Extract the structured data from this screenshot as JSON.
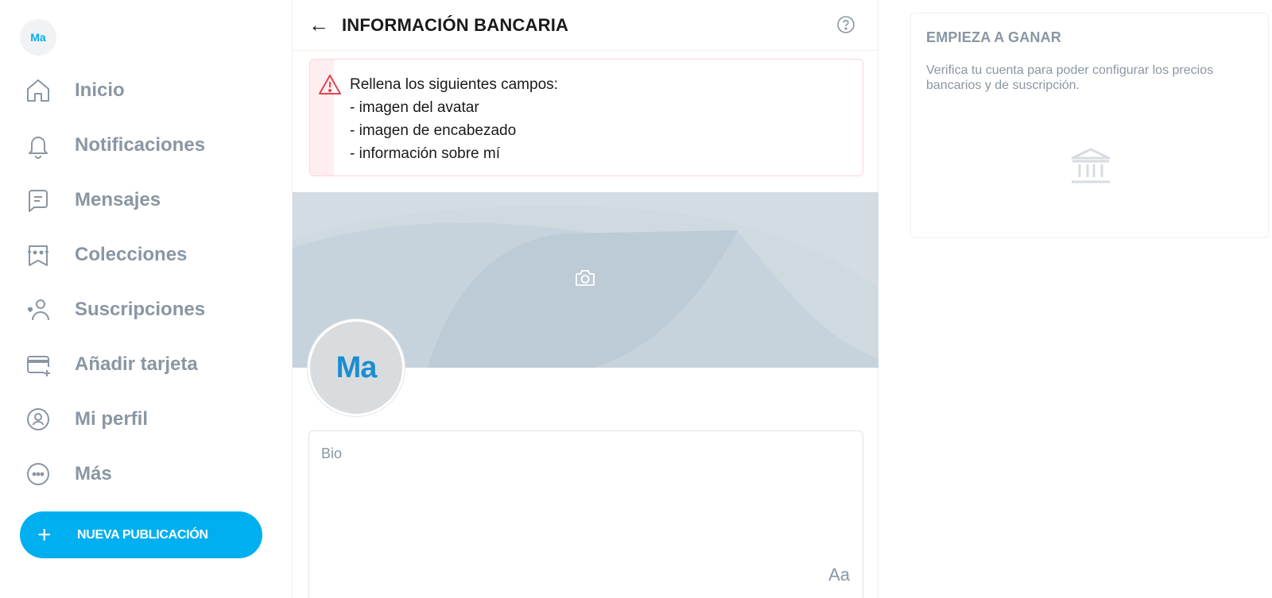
{
  "sidebar": {
    "avatar_initials": "Ma",
    "items": [
      {
        "label": "Inicio",
        "icon": "home-icon"
      },
      {
        "label": "Notificaciones",
        "icon": "bell-icon"
      },
      {
        "label": "Mensajes",
        "icon": "message-icon"
      },
      {
        "label": "Colecciones",
        "icon": "collections-icon"
      },
      {
        "label": "Suscripciones",
        "icon": "subscriptions-icon"
      },
      {
        "label": "Añadir tarjeta",
        "icon": "add-card-icon"
      },
      {
        "label": "Mi perfil",
        "icon": "profile-icon"
      },
      {
        "label": "Más",
        "icon": "more-icon"
      }
    ],
    "new_post_label": "NUEVA PUBLICACIÓN"
  },
  "main": {
    "title": "INFORMACIÓN BANCARIA",
    "alert": {
      "heading": "Rellena los siguientes campos:",
      "items": [
        "- imagen del avatar",
        "- imagen de encabezado",
        "- información sobre mí"
      ]
    },
    "avatar_initials": "Ma",
    "bio_placeholder": "Bio",
    "format_label": "Aa"
  },
  "right": {
    "title": "EMPIEZA A GANAR",
    "description": "Verifica tu cuenta para poder configurar los precios bancarios y de suscripción."
  },
  "colors": {
    "accent": "#00aff0",
    "muted": "#8a96a3",
    "alert_border": "#fbd5d8",
    "alert_icon": "#e5434e"
  }
}
